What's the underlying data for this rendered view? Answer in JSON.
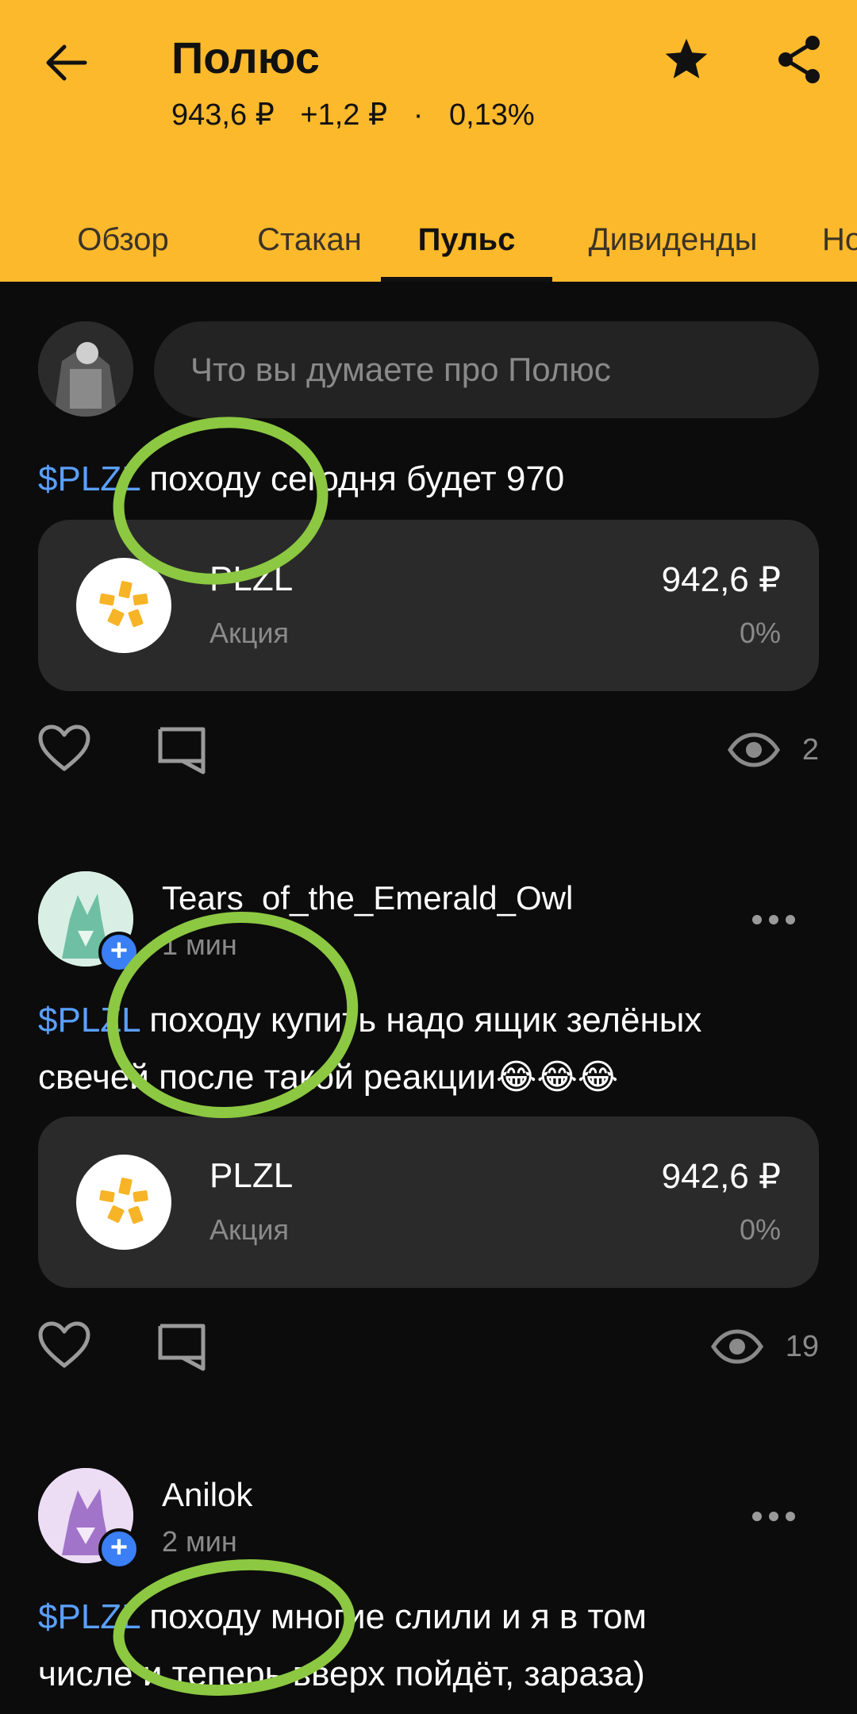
{
  "header": {
    "title": "Полюс",
    "price": "943,6 ₽",
    "change_abs": "+1,2 ₽",
    "separator": "·",
    "change_pct": "0,13%",
    "background_color": "#fdb92c"
  },
  "tabs": [
    {
      "label": "Обзор",
      "active": false
    },
    {
      "label": "Стакан",
      "active": false
    },
    {
      "label": "Пульс",
      "active": true
    },
    {
      "label": "Дивиденды",
      "active": false
    },
    {
      "label": "Но",
      "active": false
    }
  ],
  "composer": {
    "placeholder": "Что вы думаете про Полюс"
  },
  "posts": [
    {
      "ticker": "$PLZL",
      "text": " походу сегодня будет 970",
      "card": {
        "ticker": "PLZL",
        "type": "Акция",
        "price": "942,6 ₽",
        "change": "0%"
      },
      "views": "2"
    },
    {
      "author": "Tears_of_the_Emerald_Owl",
      "time": "1 мин",
      "ticker": "$PLZL",
      "line1": " походу купить надо ящик зелёных",
      "line2": "свечей после такой реакции😂😂😂",
      "card": {
        "ticker": "PLZL",
        "type": "Акция",
        "price": "942,6 ₽",
        "change": "0%"
      },
      "views": "19"
    },
    {
      "author": "Anilok",
      "time": "2 мин",
      "ticker": "$PLZL",
      "line1": " походу многие слили и я в том",
      "line2": "числе и теперь вверх пойдёт, зараза)"
    }
  ],
  "colors": {
    "accent": "#fdb92c",
    "ticker_link": "#5aa0ff",
    "annotation": "#8cc841",
    "badge": "#3a7ff6"
  }
}
